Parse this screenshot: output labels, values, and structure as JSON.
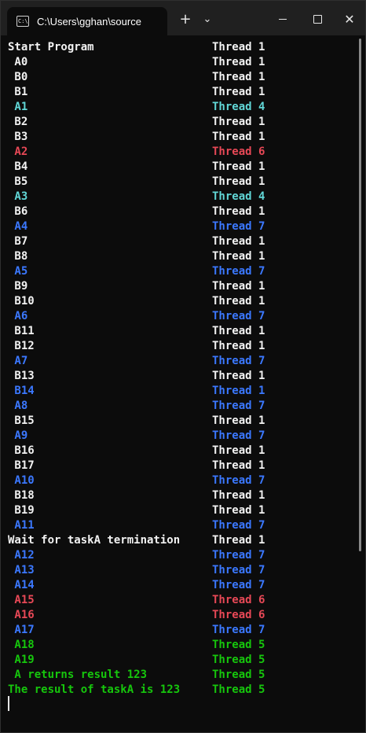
{
  "tab": {
    "title": "C:\\Users\\gghan\\source",
    "icon": "terminal-icon",
    "icon_text": "C:\\"
  },
  "titlebar": {
    "new_tab": "+",
    "dropdown": "⌄",
    "close": "✕"
  },
  "colors": {
    "white": "#f2f2f2",
    "cyan": "#61d6d6",
    "red": "#e74856",
    "blue": "#3b78ff",
    "green": "#16c60c"
  },
  "lines": [
    {
      "label": "Start Program",
      "thread": "Thread 1",
      "color": "white"
    },
    {
      "label": " A0",
      "thread": "Thread 1",
      "color": "white"
    },
    {
      "label": " B0",
      "thread": "Thread 1",
      "color": "white"
    },
    {
      "label": " B1",
      "thread": "Thread 1",
      "color": "white"
    },
    {
      "label": " A1",
      "thread": "Thread 4",
      "color": "cyan"
    },
    {
      "label": " B2",
      "thread": "Thread 1",
      "color": "white"
    },
    {
      "label": " B3",
      "thread": "Thread 1",
      "color": "white"
    },
    {
      "label": " A2",
      "thread": "Thread 6",
      "color": "red"
    },
    {
      "label": " B4",
      "thread": "Thread 1",
      "color": "white"
    },
    {
      "label": " B5",
      "thread": "Thread 1",
      "color": "white"
    },
    {
      "label": " A3",
      "thread": "Thread 4",
      "color": "cyan"
    },
    {
      "label": " B6",
      "thread": "Thread 1",
      "color": "white"
    },
    {
      "label": " A4",
      "thread": "Thread 7",
      "color": "blue"
    },
    {
      "label": " B7",
      "thread": "Thread 1",
      "color": "white"
    },
    {
      "label": " B8",
      "thread": "Thread 1",
      "color": "white"
    },
    {
      "label": " A5",
      "thread": "Thread 7",
      "color": "blue"
    },
    {
      "label": " B9",
      "thread": "Thread 1",
      "color": "white"
    },
    {
      "label": " B10",
      "thread": "Thread 1",
      "color": "white"
    },
    {
      "label": " A6",
      "thread": "Thread 7",
      "color": "blue"
    },
    {
      "label": " B11",
      "thread": "Thread 1",
      "color": "white"
    },
    {
      "label": " B12",
      "thread": "Thread 1",
      "color": "white"
    },
    {
      "label": " A7",
      "thread": "Thread 7",
      "color": "blue"
    },
    {
      "label": " B13",
      "thread": "Thread 1",
      "color": "white"
    },
    {
      "label": " B14",
      "thread": "Thread 1",
      "color": "blue"
    },
    {
      "label": " A8",
      "thread": "Thread 7",
      "color": "blue"
    },
    {
      "label": " B15",
      "thread": "Thread 1",
      "color": "white"
    },
    {
      "label": " A9",
      "thread": "Thread 7",
      "color": "blue"
    },
    {
      "label": " B16",
      "thread": "Thread 1",
      "color": "white"
    },
    {
      "label": " B17",
      "thread": "Thread 1",
      "color": "white"
    },
    {
      "label": " A10",
      "thread": "Thread 7",
      "color": "blue"
    },
    {
      "label": " B18",
      "thread": "Thread 1",
      "color": "white"
    },
    {
      "label": " B19",
      "thread": "Thread 1",
      "color": "white"
    },
    {
      "label": " A11",
      "thread": "Thread 7",
      "color": "blue"
    },
    {
      "label": "Wait for taskA termination",
      "thread": "Thread 1",
      "color": "white"
    },
    {
      "label": " A12",
      "thread": "Thread 7",
      "color": "blue"
    },
    {
      "label": " A13",
      "thread": "Thread 7",
      "color": "blue"
    },
    {
      "label": " A14",
      "thread": "Thread 7",
      "color": "blue"
    },
    {
      "label": " A15",
      "thread": "Thread 6",
      "color": "red"
    },
    {
      "label": " A16",
      "thread": "Thread 6",
      "color": "red"
    },
    {
      "label": " A17",
      "thread": "Thread 7",
      "color": "blue"
    },
    {
      "label": " A18",
      "thread": "Thread 5",
      "color": "green"
    },
    {
      "label": " A19",
      "thread": "Thread 5",
      "color": "green"
    },
    {
      "label": " A returns result 123",
      "thread": "Thread 5",
      "color": "green"
    },
    {
      "label": "The result of taskA is 123",
      "thread": "Thread 5",
      "color": "green"
    }
  ]
}
